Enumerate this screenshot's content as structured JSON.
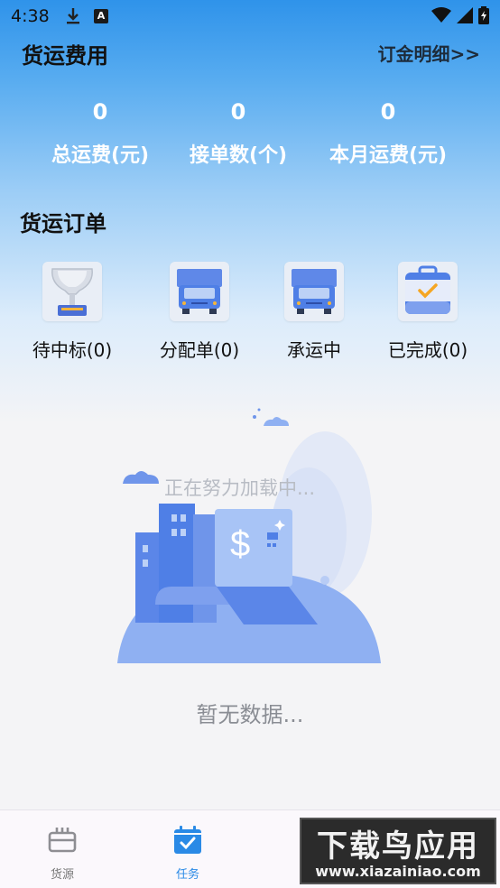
{
  "status_bar": {
    "time": "4:38",
    "icons": [
      "download-icon",
      "a-badge-icon",
      "wifi-icon",
      "cell-signal-icon",
      "battery-icon"
    ],
    "a_badge": "A"
  },
  "header": {
    "title": "货运费用",
    "deposit_link": "订金明细>>"
  },
  "stats": [
    {
      "value": "0",
      "label": "总运费(元)"
    },
    {
      "value": "0",
      "label": "接单数(个)"
    },
    {
      "value": "0",
      "label": "本月运费(元)"
    }
  ],
  "orders_section": {
    "title": "货运订单",
    "items": [
      {
        "label": "待中标(0)",
        "icon": "trophy-icon"
      },
      {
        "label": "分配单(0)",
        "icon": "truck-icon"
      },
      {
        "label": "承运中",
        "icon": "truck-icon"
      },
      {
        "label": "已完成(0)",
        "icon": "completed-bag-icon"
      }
    ]
  },
  "empty_state": {
    "loading_text": "正在努力加载中...",
    "empty_text": "暂无数据..."
  },
  "tab_bar": {
    "tabs": [
      {
        "label": "货源",
        "icon": "cargo-box-icon",
        "active": false
      },
      {
        "label": "任务",
        "icon": "calendar-check-icon",
        "active": true
      },
      {
        "label": "",
        "icon": "tab-icon",
        "active": false
      }
    ]
  },
  "watermark": {
    "main": "下载鸟应用",
    "sub": "www.xiazainiao.com"
  },
  "colors": {
    "accent": "#2a8ae6",
    "header_gradient_top": "#2f93ea",
    "background": "#f4f4f6"
  }
}
